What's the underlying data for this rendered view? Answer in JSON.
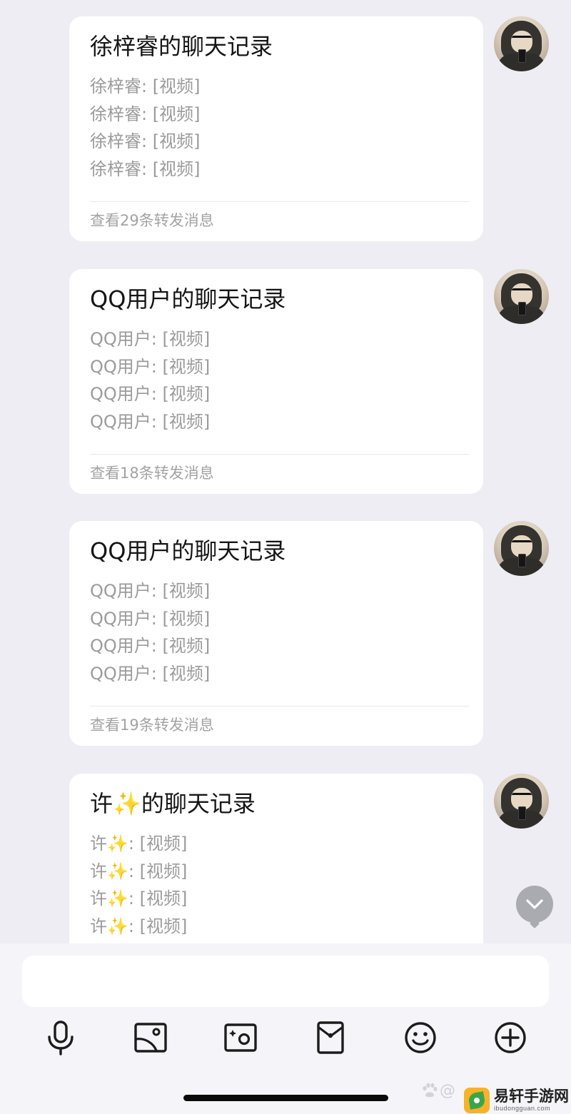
{
  "messages": [
    {
      "title": "徐梓睿的聊天记录",
      "lines": [
        "徐梓睿: [视频]",
        "徐梓睿: [视频]",
        "徐梓睿: [视频]",
        "徐梓睿: [视频]"
      ],
      "footer": "查看29条转发消息"
    },
    {
      "title": "QQ用户的聊天记录",
      "lines": [
        "QQ用户: [视频]",
        "QQ用户: [视频]",
        "QQ用户: [视频]",
        "QQ用户: [视频]"
      ],
      "footer": "查看18条转发消息"
    },
    {
      "title": "QQ用户的聊天记录",
      "lines": [
        "QQ用户: [视频]",
        "QQ用户: [视频]",
        "QQ用户: [视频]",
        "QQ用户: [视频]"
      ],
      "footer": "查看19条转发消息"
    },
    {
      "title": "许✨的聊天记录",
      "lines": [
        "许✨: [视频]",
        "许✨: [视频]",
        "许✨: [视频]",
        "许✨: [视频]"
      ],
      "footer": ""
    }
  ],
  "toolbar": {
    "icons": [
      "microphone-icon",
      "photo-icon",
      "camera-icon",
      "red-packet-icon",
      "emoji-icon",
      "plus-icon"
    ]
  },
  "scroll_down": {
    "icon": "chevron-down-icon"
  },
  "watermark": {
    "handle": "@",
    "name": "易轩手游网",
    "domain": "ibudongguan.com"
  },
  "colors": {
    "background": "#ededf3",
    "card": "#ffffff",
    "title": "#151515",
    "secondary_text": "#9b9b9b",
    "scroll_button": "#aaaab1"
  }
}
